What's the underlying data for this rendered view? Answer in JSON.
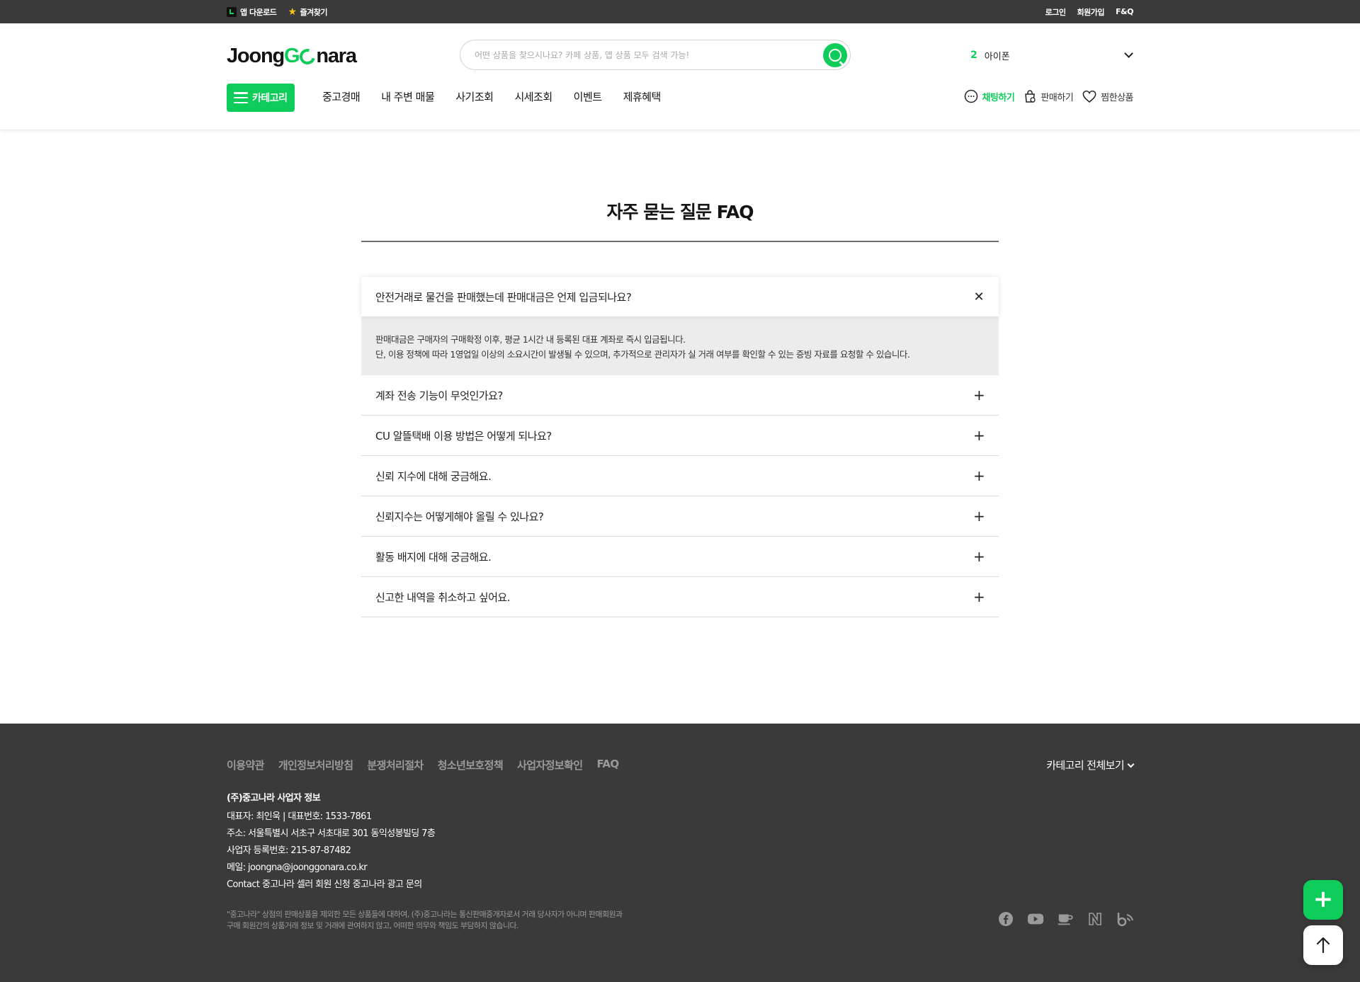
{
  "topbar": {
    "app_download": "앱 다운로드",
    "bookmark": "즐겨찾기",
    "login": "로그인",
    "signup": "회원가입",
    "faq": "F&Q"
  },
  "header": {
    "logo": {
      "part1": "Joong",
      "part2": "G",
      "part3": "nara"
    },
    "search_placeholder": "어떤 상품을 찾으시나요? 카페 상품, 앱 상품 모두 검색 가능!",
    "trending": {
      "rank": "2",
      "keyword": "아이폰"
    },
    "category_button": "카테고리",
    "nav": [
      "중고경매",
      "내 주변 매물",
      "사기조회",
      "시세조회",
      "이벤트",
      "제휴혜택"
    ],
    "actions": {
      "chat": "채팅하기",
      "sell": "판매하기",
      "wishlist": "찜한상품"
    }
  },
  "faq": {
    "title": "자주 묻는 질문 FAQ",
    "open_item": {
      "question": "안전거래로 물건을 판매했는데 판매대금은 언제 입금되나요?",
      "answer": [
        "판매대금은 구매자의 구매확정 이후, 평균 1시간 내 등록된 대표 계좌로 즉시 입금됩니다.",
        "단, 이용 정책에 따라 1영업일 이상의 소요시간이 발생될 수 있으며, 추가적으로 관리자가 실 거래 여부를 확인할 수 있는 증빙 자료를 요청할 수 있습니다."
      ]
    },
    "items": [
      "계좌 전송 기능이 무엇인가요?",
      "CU 알뜰택배 이용 방법은 어떻게 되나요?",
      "신뢰 지수에 대해 궁금해요.",
      "신뢰지수는 어떻게해야 올릴 수 있나요?",
      "활동 배지에 대해 궁금해요.",
      "신고한 내역을 취소하고 싶어요."
    ]
  },
  "footer": {
    "links": [
      "이용약관",
      "개인정보처리방침",
      "분쟁처리절차",
      "청소년보호정책",
      "사업자정보확인",
      "FAQ"
    ],
    "category_all": "카테고리 전체보기",
    "company_title": "(주)중고나라 사업자 정보",
    "company_lines": [
      "대표자: 최인욱 | 대표번호: 1533-7861",
      "주소: 서울특별시 서초구 서초대로 301 동익성봉빌딩 7층",
      "사업자 등록번호: 215-87-87482",
      "메일: joongna@joonggonara.co.kr"
    ],
    "contact": {
      "label": "Contact",
      "seller": "중고나라 셀러 회원 신청",
      "ad": "중고나라 광고 문의"
    },
    "disclaimer": [
      "\"중고나라\" 상점의 판매상품을 제외한 모든 상품들에 대하여, (주)중고나라는 통신판매중개자로서 거래 당사자가 아니며 판매회원과",
      "구매 회원간의 상품거래 정보 및 거래에 관여하지 않고, 어떠한 의무와 책임도 부담하지 않습니다."
    ],
    "socials": [
      "facebook-icon",
      "youtube-icon",
      "cafe-icon",
      "naver-icon",
      "blog-icon"
    ]
  },
  "colors": {
    "brand_green": "#0dcc5a",
    "dark_bar": "#3a3a3a",
    "answer_bg": "#ececec"
  }
}
